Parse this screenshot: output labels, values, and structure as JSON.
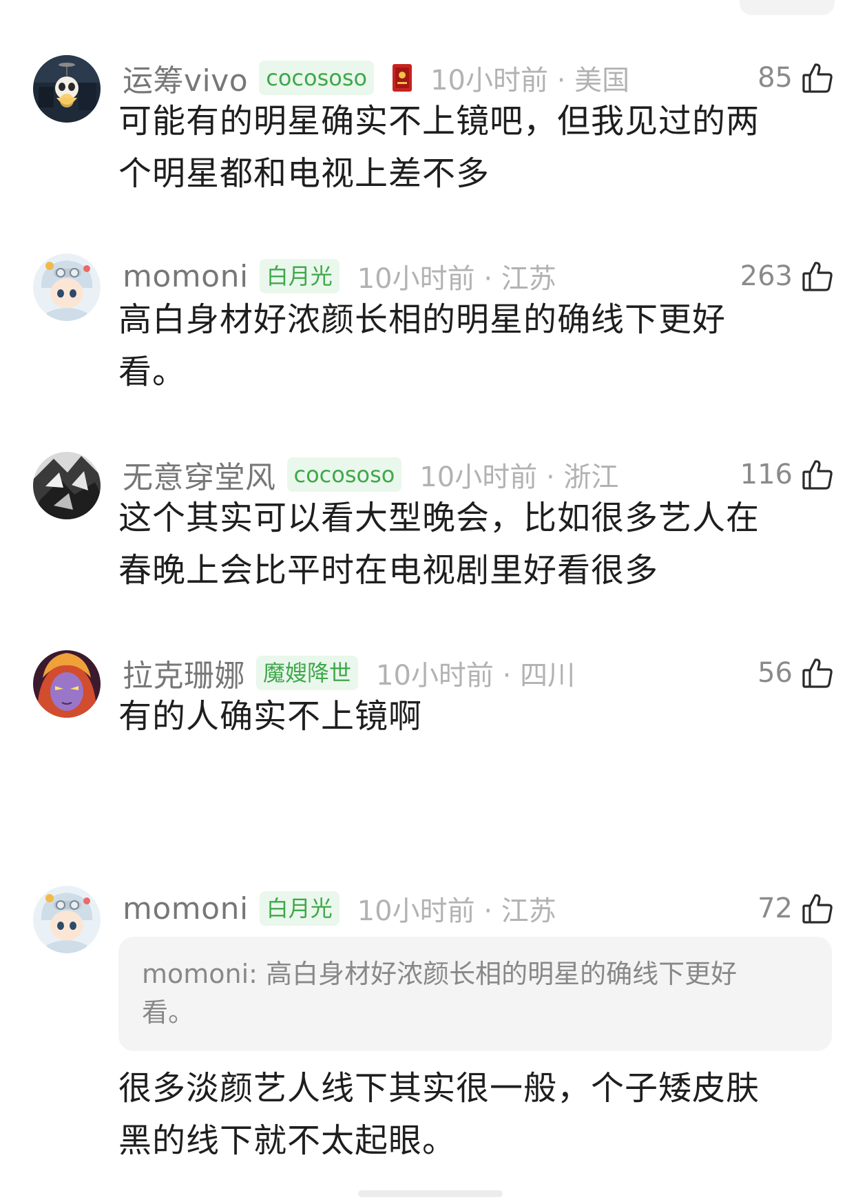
{
  "comments": [
    {
      "username": "运筹vivo",
      "badge": "cocososo",
      "time": "10小时前",
      "location": "美国",
      "likes": "85",
      "lines": [
        "可能有的明星确实不上镜吧，但我见过的两",
        "个明星都和电视上差不多"
      ]
    },
    {
      "username": "momoni",
      "badge": "白月光",
      "time": "10小时前",
      "location": "江苏",
      "likes": "263",
      "lines": [
        "高白身材好浓颜长相的明星的确线下更好",
        "看。"
      ]
    },
    {
      "username": "无意穿堂风",
      "badge": "cocososo",
      "time": "10小时前",
      "location": "浙江",
      "likes": "116",
      "lines": [
        "这个其实可以看大型晚会，比如很多艺人在",
        "春晚上会比平时在电视剧里好看很多"
      ]
    },
    {
      "username": "拉克珊娜",
      "badge": "魔嫂降世",
      "time": "10小时前",
      "location": "四川",
      "likes": "56",
      "lines": [
        "有的人确实不上镜啊"
      ]
    },
    {
      "username": "momoni",
      "badge": "白月光",
      "time": "10小时前",
      "location": "江苏",
      "likes": "72",
      "quote_user": "momoni:",
      "quote_lines": [
        "高白身材好浓颜长相的明星的确线下更好",
        "看。"
      ],
      "lines": [
        "很多淡颜艺人线下其实很一般，个子矮皮肤",
        "黑的线下就不太起眼。"
      ]
    }
  ],
  "separator": "·",
  "icons": {
    "like": "thumbs-up-icon",
    "medal": "red-card-medal-icon"
  },
  "colors": {
    "badge_text": "#3ea84a",
    "badge_bg": "#eaf7ec",
    "username": "#777777",
    "meta": "#b2b2b2"
  }
}
